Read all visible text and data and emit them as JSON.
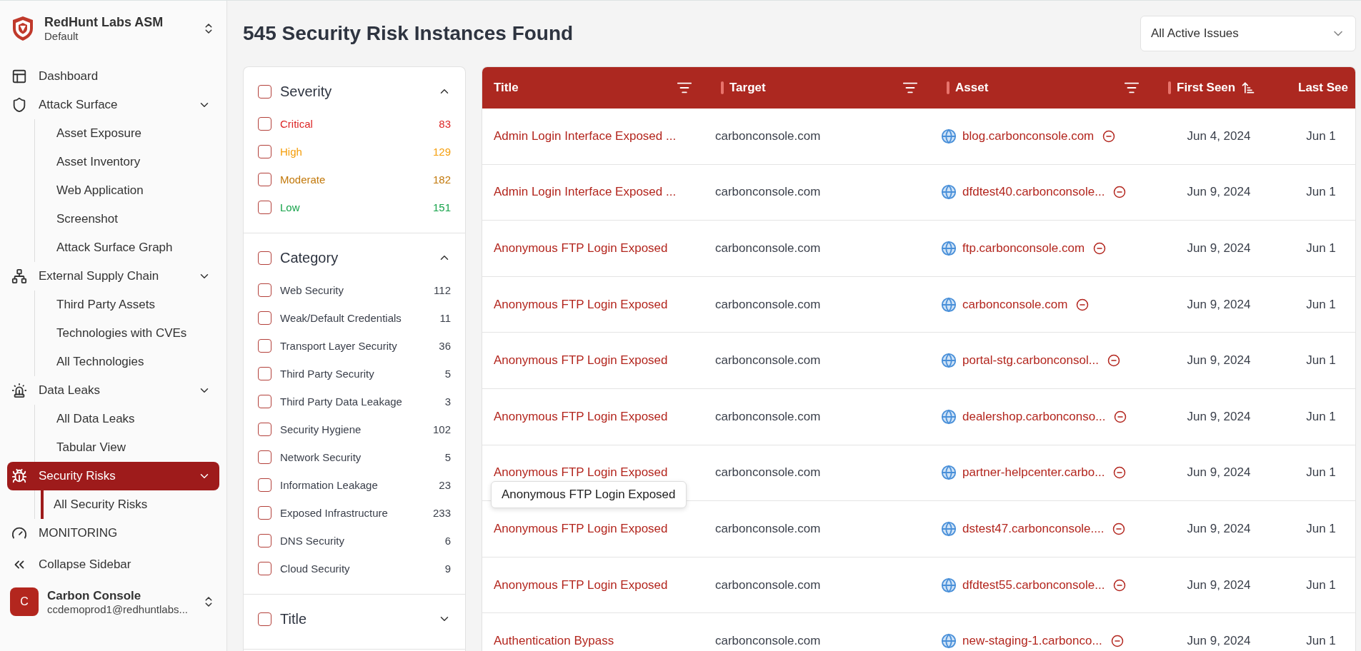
{
  "sidebar": {
    "brand": {
      "name": "RedHunt Labs ASM",
      "workspace": "Default"
    },
    "nav": [
      {
        "label": "Dashboard",
        "selected": false
      },
      {
        "label": "Attack Surface",
        "selected": false,
        "expanded": true,
        "children": [
          {
            "label": "Asset Exposure",
            "selected": false
          },
          {
            "label": "Asset Inventory",
            "selected": false
          },
          {
            "label": "Web Application",
            "selected": false
          },
          {
            "label": "Screenshot",
            "selected": false
          },
          {
            "label": "Attack Surface Graph",
            "selected": false
          }
        ]
      },
      {
        "label": "External Supply Chain",
        "selected": false,
        "expanded": true,
        "children": [
          {
            "label": "Third Party Assets",
            "selected": false
          },
          {
            "label": "Technologies with CVEs",
            "selected": false
          },
          {
            "label": "All Technologies",
            "selected": false
          }
        ]
      },
      {
        "label": "Data Leaks",
        "selected": false,
        "expanded": true,
        "children": [
          {
            "label": "All Data Leaks",
            "selected": false
          },
          {
            "label": "Tabular View",
            "selected": false
          }
        ]
      },
      {
        "label": "Security Risks",
        "selected": true,
        "expanded": true,
        "children": [
          {
            "label": "All Security Risks",
            "selected": true
          }
        ]
      },
      {
        "label": "MONITORING",
        "selected": false
      }
    ],
    "collapse": {
      "label": "Collapse Sidebar"
    },
    "account": {
      "initial": "C",
      "name": "Carbon Console",
      "email": "ccdemoprod1@redhuntlabs..."
    }
  },
  "page_title": "545 Security Risk Instances Found",
  "issue_filter": {
    "value": "All Active Issues"
  },
  "filters": [
    {
      "title": "Severity",
      "checked": false,
      "expanded": true,
      "options": [
        {
          "label": "Critical",
          "count": "83",
          "checked": false,
          "color": "#dc2626"
        },
        {
          "label": "High",
          "count": "129",
          "checked": false,
          "color": "#f59e0b"
        },
        {
          "label": "Moderate",
          "count": "182",
          "checked": false,
          "color": "#c2780a"
        },
        {
          "label": "Low",
          "count": "151",
          "checked": false,
          "color": "#16a34a"
        }
      ]
    },
    {
      "title": "Category",
      "checked": false,
      "expanded": true,
      "options": [
        {
          "label": "Web Security",
          "count": "112",
          "checked": false
        },
        {
          "label": "Weak/Default Credentials",
          "count": "11",
          "checked": false
        },
        {
          "label": "Transport Layer Security",
          "count": "36",
          "checked": false
        },
        {
          "label": "Third Party Security",
          "count": "5",
          "checked": false
        },
        {
          "label": "Third Party Data Leakage",
          "count": "3",
          "checked": false
        },
        {
          "label": "Security Hygiene",
          "count": "102",
          "checked": false
        },
        {
          "label": "Network Security",
          "count": "5",
          "checked": false
        },
        {
          "label": "Information Leakage",
          "count": "23",
          "checked": false
        },
        {
          "label": "Exposed Infrastructure",
          "count": "233",
          "checked": false
        },
        {
          "label": "DNS Security",
          "count": "6",
          "checked": false
        },
        {
          "label": "Cloud Security",
          "count": "9",
          "checked": false
        }
      ]
    },
    {
      "title": "Title",
      "checked": false,
      "expanded": false
    }
  ],
  "table": {
    "columns": [
      {
        "label": "Title",
        "kind": "filter"
      },
      {
        "label": "Target",
        "kind": "filter"
      },
      {
        "label": "Asset",
        "kind": "filter"
      },
      {
        "label": "First Seen",
        "kind": "sort"
      },
      {
        "label": "Last See",
        "kind": "plain"
      }
    ],
    "rows": [
      {
        "title": "Admin Login Interface Exposed ...",
        "target": "carbonconsole.com",
        "asset": "blog.carbonconsole.com",
        "first_seen": "Jun 4, 2024",
        "last_seen": "Jun 1"
      },
      {
        "title": "Admin Login Interface Exposed ...",
        "target": "carbonconsole.com",
        "asset": "dfdtest40.carbonconsole...",
        "first_seen": "Jun 9, 2024",
        "last_seen": "Jun 1"
      },
      {
        "title": "Anonymous FTP Login Exposed",
        "target": "carbonconsole.com",
        "asset": "ftp.carbonconsole.com",
        "first_seen": "Jun 9, 2024",
        "last_seen": "Jun 1"
      },
      {
        "title": "Anonymous FTP Login Exposed",
        "target": "carbonconsole.com",
        "asset": "carbonconsole.com",
        "first_seen": "Jun 9, 2024",
        "last_seen": "Jun 1"
      },
      {
        "title": "Anonymous FTP Login Exposed",
        "target": "carbonconsole.com",
        "asset": "portal-stg.carbonconsol...",
        "first_seen": "Jun 9, 2024",
        "last_seen": "Jun 1"
      },
      {
        "title": "Anonymous FTP Login Exposed",
        "target": "carbonconsole.com",
        "asset": "dealershop.carbonconso...",
        "first_seen": "Jun 9, 2024",
        "last_seen": "Jun 1"
      },
      {
        "title": "Anonymous FTP Login Exposed",
        "target": "carbonconsole.com",
        "asset": "partner-helpcenter.carbo...",
        "first_seen": "Jun 9, 2024",
        "last_seen": "Jun 1",
        "tooltip": "Anonymous FTP Login Exposed"
      },
      {
        "title": "Anonymous FTP Login Exposed",
        "target": "carbonconsole.com",
        "asset": "dstest47.carbonconsole....",
        "first_seen": "Jun 9, 2024",
        "last_seen": "Jun 1"
      },
      {
        "title": "Anonymous FTP Login Exposed",
        "target": "carbonconsole.com",
        "asset": "dfdtest55.carbonconsole...",
        "first_seen": "Jun 9, 2024",
        "last_seen": "Jun 1"
      },
      {
        "title": "Authentication Bypass",
        "target": "carbonconsole.com",
        "asset": "new-staging-1.carbonco...",
        "first_seen": "Jun 9, 2024",
        "last_seen": "Jun 1"
      }
    ]
  }
}
